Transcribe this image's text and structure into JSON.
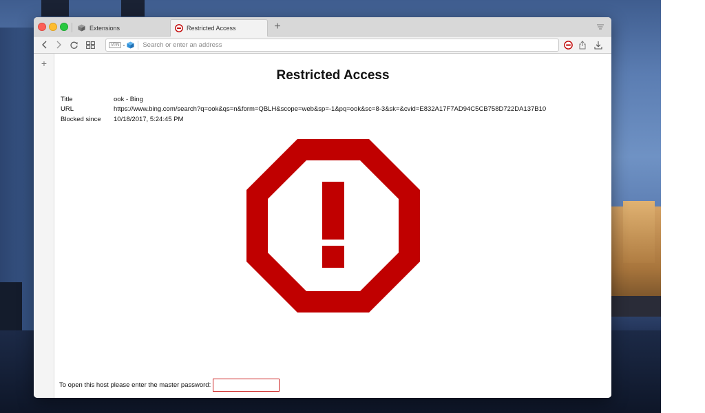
{
  "tabs": [
    {
      "label": "Extensions",
      "icon": "cube-icon",
      "active": false
    },
    {
      "label": "Restricted Access",
      "icon": "block-icon",
      "active": true
    }
  ],
  "toolbar": {
    "vpn_label": "VPN",
    "address_placeholder": "Search or enter an address",
    "address_value": ""
  },
  "page": {
    "title": "Restricted Access",
    "info": [
      {
        "key": "Title",
        "value": "ook - Bing"
      },
      {
        "key": "URL",
        "value": "https://www.bing.com/search?q=ook&qs=n&form=QBLH&scope=web&sp=-1&pq=ook&sc=8-3&sk=&cvid=E832A17F7AD94C5CB758D722DA137B10"
      },
      {
        "key": "Blocked since",
        "value": "10/18/2017, 5:24:45 PM"
      }
    ],
    "password_prompt": "To open this host please enter the master password:",
    "password_value": ""
  },
  "colors": {
    "warning_red": "#c00000",
    "password_border": "#cc1f1f"
  }
}
